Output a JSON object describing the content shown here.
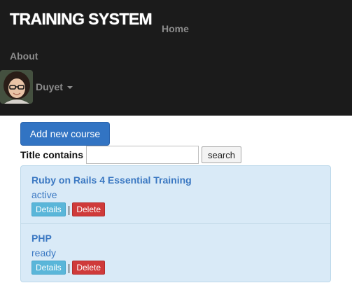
{
  "navbar": {
    "brand": "TRAINING SYSTEM",
    "links": [
      {
        "label": "Home"
      },
      {
        "label": "About"
      }
    ],
    "user": {
      "name": "Duyet",
      "avatar_icon": "user-avatar-photo"
    }
  },
  "toolbar": {
    "add_course_label": "Add new course"
  },
  "search": {
    "label": "Title contains",
    "value": "",
    "button_label": "search"
  },
  "courses": [
    {
      "title": "Ruby on Rails 4 Essential Training",
      "status": "active",
      "details_label": "Details",
      "separator": "|",
      "delete_label": "Delete"
    },
    {
      "title": "PHP",
      "status": "ready",
      "details_label": "Details",
      "separator": "|",
      "delete_label": "Delete"
    }
  ],
  "colors": {
    "navbar_bg": "#1b1b1b",
    "primary": "#3274c3",
    "info": "#5ab6d9",
    "danger": "#cf3a3a",
    "list_bg": "#d9eaf7",
    "link": "#3b78c2"
  }
}
